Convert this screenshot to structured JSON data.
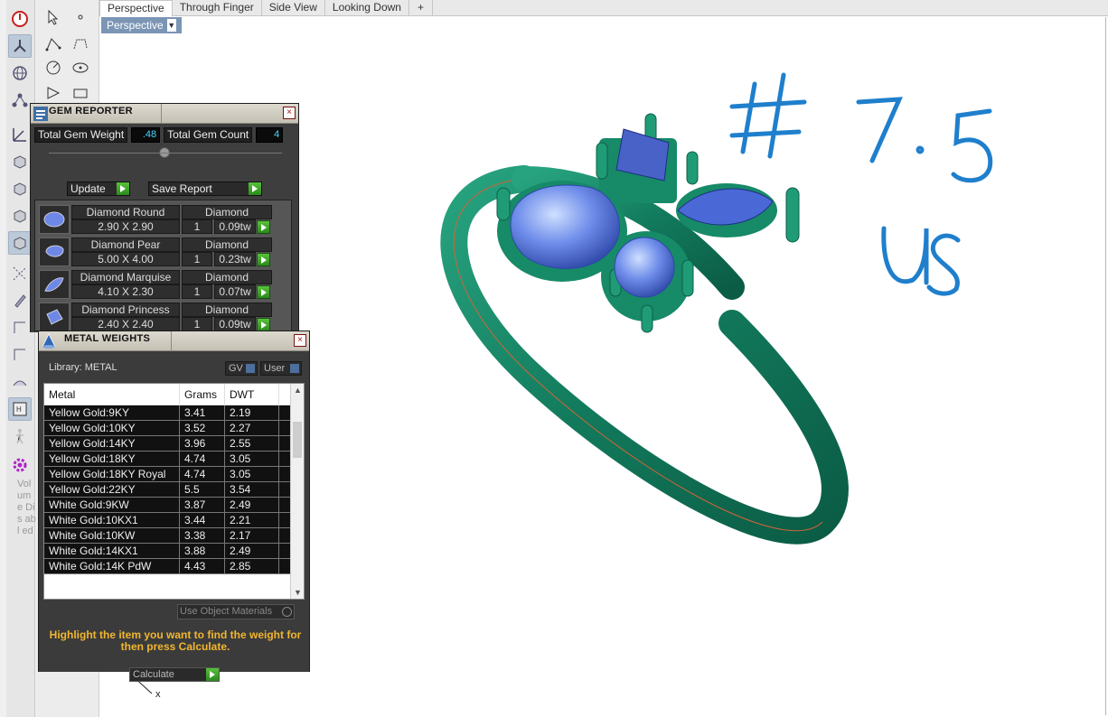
{
  "tabs": [
    {
      "label": "Perspective"
    },
    {
      "label": "Through Finger"
    },
    {
      "label": "Side View"
    },
    {
      "label": "Looking Down"
    }
  ],
  "tab_add_label": "+",
  "viewport": {
    "label": "Perspective",
    "axis_x": "x",
    "annotation_line1": "# 7.5",
    "annotation_line2": "US",
    "ring_color": "#1a8a6c",
    "gem_color": "#5a78e0",
    "annotation_color": "#1f7fcc"
  },
  "left_toolbar": {
    "volume_disabled_text": "Vol um e Dis abl ed"
  },
  "gem_reporter": {
    "title": "GEM REPORTER",
    "close": "×",
    "total_weight_label": "Total Gem Weight",
    "total_weight_value": ".48",
    "total_count_label": "Total Gem Count",
    "total_count_value": "4",
    "update_label": "Update",
    "save_report_label": "Save Report",
    "gems": [
      {
        "name": "Diamond Round",
        "material": "Diamond",
        "size": "2.90 X 2.90",
        "qty": "1",
        "weight": "0.09tw",
        "shape": "round-gem-icon"
      },
      {
        "name": "Diamond Pear",
        "material": "Diamond",
        "size": "5.00 X 4.00",
        "qty": "1",
        "weight": "0.23tw",
        "shape": "pear-gem-icon"
      },
      {
        "name": "Diamond Marquise",
        "material": "Diamond",
        "size": "4.10 X 2.30",
        "qty": "1",
        "weight": "0.07tw",
        "shape": "marquise-gem-icon"
      },
      {
        "name": "Diamond Princess",
        "material": "Diamond",
        "size": "2.40 X 2.40",
        "qty": "1",
        "weight": "0.09tw",
        "shape": "princess-gem-icon"
      }
    ]
  },
  "metal_weights": {
    "title": "METAL WEIGHTS",
    "close": "×",
    "library_label": "Library: METAL",
    "gv_label": "GV",
    "user_label": "User",
    "columns": [
      "Metal",
      "Grams",
      "DWT"
    ],
    "rows": [
      [
        "Yellow Gold:9KY",
        "3.41",
        "2.19"
      ],
      [
        "Yellow Gold:10KY",
        "3.52",
        "2.27"
      ],
      [
        "Yellow Gold:14KY",
        "3.96",
        "2.55"
      ],
      [
        "Yellow Gold:18KY",
        "4.74",
        "3.05"
      ],
      [
        "Yellow Gold:18KY Royal",
        "4.74",
        "3.05"
      ],
      [
        "Yellow Gold:22KY",
        "5.5",
        "3.54"
      ],
      [
        "White Gold:9KW",
        "3.87",
        "2.49"
      ],
      [
        "White Gold:10KX1",
        "3.44",
        "2.21"
      ],
      [
        "White Gold:10KW",
        "3.38",
        "2.17"
      ],
      [
        "White Gold:14KX1",
        "3.88",
        "2.49"
      ],
      [
        "White Gold:14K PdW",
        "4.43",
        "2.85"
      ]
    ],
    "use_object_materials_label": "Use Object Materials",
    "hint_text": "Highlight the item you want to find the weight for then press Calculate.",
    "calculate_label": "Calculate"
  }
}
